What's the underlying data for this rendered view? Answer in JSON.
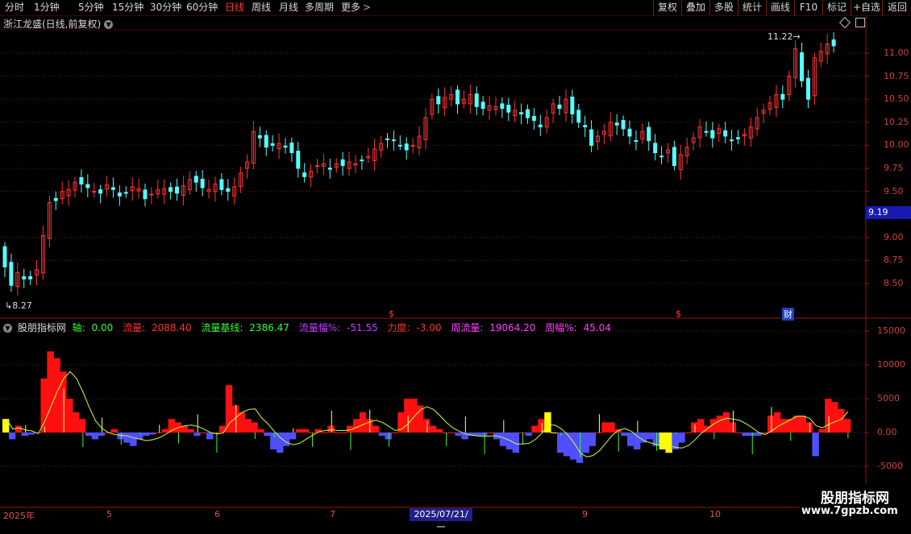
{
  "toolbar": {
    "periods": [
      "分时",
      "1分钟",
      "5分钟",
      "15分钟",
      "30分钟",
      "60分钟",
      "日线",
      "周线",
      "月线",
      "多周期",
      "更多"
    ],
    "active": "日线",
    "right_buttons": [
      "复权",
      "叠加",
      "多股",
      "统计",
      "画线",
      "F10",
      "标记",
      "+自选",
      "返回"
    ]
  },
  "chart_title": "浙江龙盛(日线,前复权)",
  "price_axis": {
    "ticks": [
      "11.00",
      "10.75",
      "10.50",
      "10.25",
      "10.00",
      "9.75",
      "9.50",
      "9.00",
      "8.75",
      "8.50"
    ],
    "current_price": "9.19",
    "high_label": "11.22",
    "low_label": "8.27"
  },
  "indicator": {
    "name": "股朋指标网",
    "axis": {
      "label": "轴:",
      "value": "0.00",
      "color": "#33ff33"
    },
    "flow": {
      "label": "流量:",
      "value": "2088.40",
      "color": "#ff3030"
    },
    "baseline": {
      "label": "流量基线:",
      "value": "2386.47",
      "color": "#33ff33"
    },
    "flow_pct": {
      "label": "流量幅%:",
      "value": "-51.55",
      "color": "#c040ff"
    },
    "force": {
      "label": "力度:",
      "value": "-3.00",
      "color": "#ff3030"
    },
    "week_flow": {
      "label": "周流量:",
      "value": "19064.20",
      "color": "#ff40ff"
    },
    "week_pct": {
      "label": "周幅%:",
      "value": "45.04",
      "color": "#ff40ff"
    },
    "ticks": [
      "15000",
      "10000",
      "5000",
      "0.00",
      "-5000"
    ]
  },
  "markers": [
    "$",
    "$",
    "财"
  ],
  "dates": [
    "2025年",
    "5",
    "6",
    "7",
    "2025/07/21/一",
    "9",
    "10"
  ],
  "watermark": {
    "title": "股朋指标网",
    "url": "www.7gpzb.com"
  },
  "colors": {
    "up": "#ff3333",
    "down": "#54ffff",
    "bar_up": "#ff1010",
    "bar_down": "#4f4fff",
    "bar_yellow": "#ffff00",
    "ma": "#c8ff40"
  }
}
